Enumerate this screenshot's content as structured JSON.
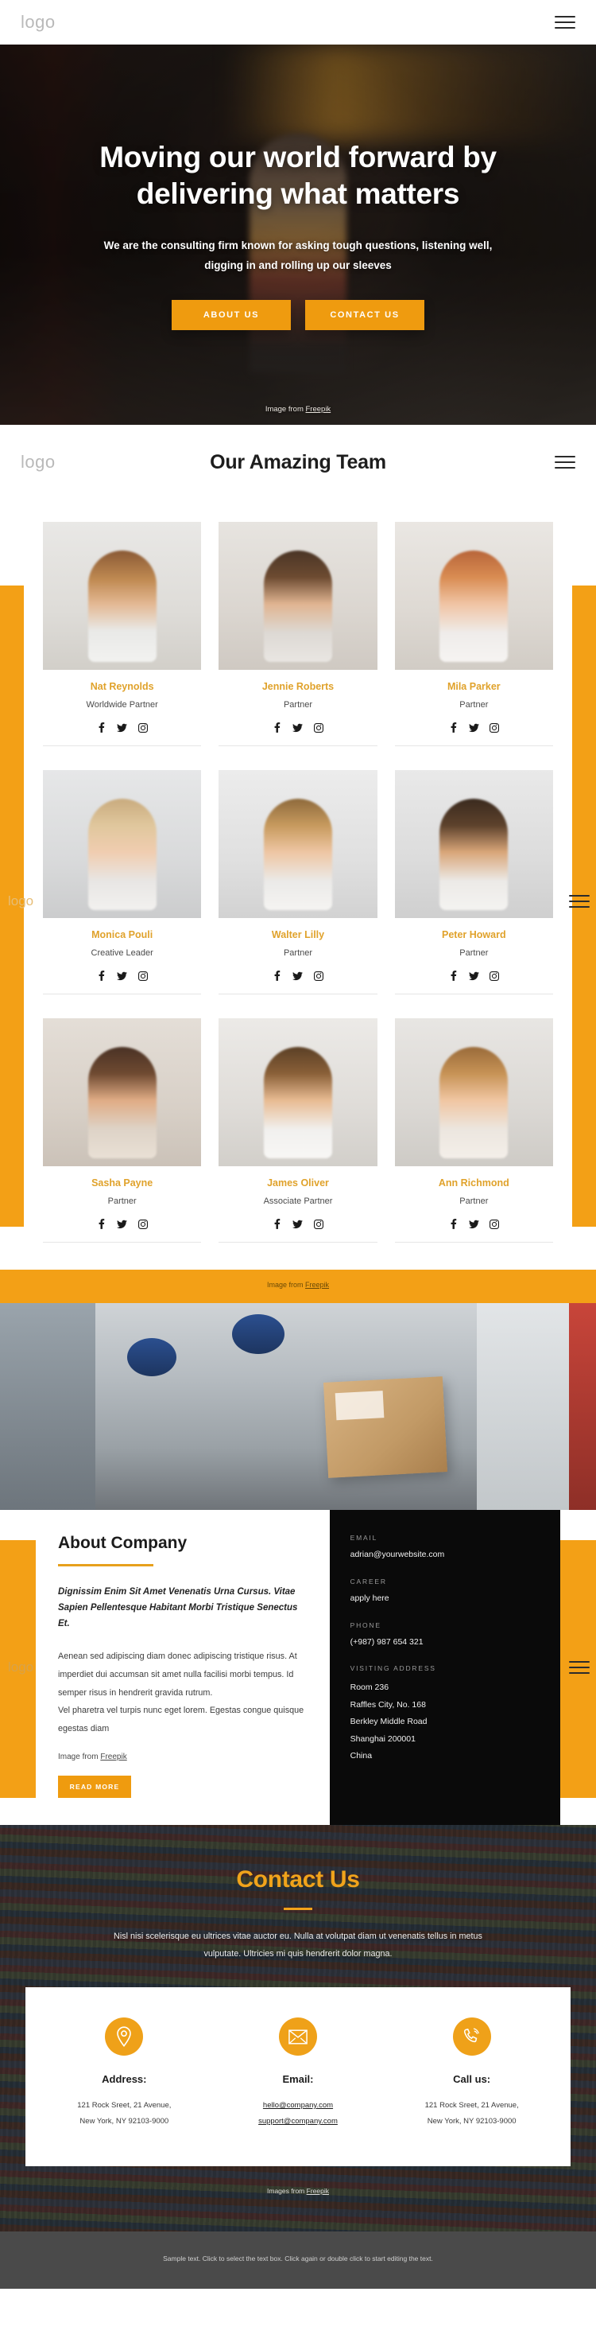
{
  "brand": {
    "logo": "logo",
    "accent": "#ef9b0f",
    "dark": "#0a0a0a"
  },
  "topbar": {
    "logo": "logo",
    "menu_icon": "hamburger-icon"
  },
  "hero": {
    "title": "Moving our world forward by delivering what matters",
    "subtitle": "We are the consulting firm known for asking tough questions, listening well, digging in and rolling up our sleeves",
    "buttons": [
      {
        "label": "ABOUT US"
      },
      {
        "label": "CONTACT US"
      }
    ],
    "credit_prefix": "Image from ",
    "credit_link": "Freepik"
  },
  "team": {
    "logo": "logo",
    "title": "Our Amazing Team",
    "menu_icon": "hamburger-icon",
    "socials": [
      "facebook-icon",
      "twitter-icon",
      "instagram-icon"
    ],
    "members": [
      {
        "name": "Nat Reynolds",
        "role": "Worldwide Partner"
      },
      {
        "name": "Jennie Roberts",
        "role": "Partner"
      },
      {
        "name": "Mila Parker",
        "role": "Partner"
      },
      {
        "name": "Monica Pouli",
        "role": "Creative Leader"
      },
      {
        "name": "Walter Lilly",
        "role": "Partner"
      },
      {
        "name": "Peter Howard",
        "role": "Partner"
      },
      {
        "name": "Sasha Payne",
        "role": "Partner"
      },
      {
        "name": "James Oliver",
        "role": "Associate Partner"
      },
      {
        "name": "Ann Richmond",
        "role": "Partner"
      }
    ],
    "credit_prefix": "Image from ",
    "credit_link": "Freepik"
  },
  "about": {
    "logo": "logo",
    "menu_icon": "hamburger-icon",
    "heading": "About Company",
    "lead": "Dignissim Enim Sit Amet Venenatis Urna Cursus. Vitae Sapien Pellentesque Habitant Morbi Tristique Senectus Et.",
    "paragraphs": [
      "Aenean sed adipiscing diam donec adipiscing tristique risus. At imperdiet dui accumsan sit amet nulla facilisi morbi tempus. Id semper risus in hendrerit gravida rutrum.",
      "Vel pharetra vel turpis nunc eget lorem. Egestas congue quisque egestas diam"
    ],
    "credit_prefix": "Image from ",
    "credit_link": "Freepik",
    "read_more": "READ MORE",
    "contact_info": {
      "email_label": "EMAIL",
      "email_value": "adrian@yourwebsite.com",
      "career_label": "CAREER",
      "career_value": "apply here",
      "phone_label": "PHONE",
      "phone_value": "(+987) 987 654 321",
      "address_label": "VISITING ADDRESS",
      "address_lines": [
        "Room 236",
        "Raffles City, No. 168",
        "Berkley Middle Road",
        "Shanghai 200001",
        "China"
      ]
    }
  },
  "contact": {
    "title": "Contact Us",
    "subtitle": "Nisl nisi scelerisque eu ultrices vitae auctor eu. Nulla at volutpat diam ut venenatis tellus in metus vulputate. Ultricies mi quis hendrerit dolor magna.",
    "columns": [
      {
        "icon": "location-pin-icon",
        "title": "Address:",
        "lines": [
          "121 Rock Sreet, 21 Avenue,",
          "New York, NY 92103-9000"
        ],
        "linked": false
      },
      {
        "icon": "envelope-icon",
        "title": "Email:",
        "lines": [
          "hello@company.com",
          "support@company.com"
        ],
        "linked": true
      },
      {
        "icon": "phone-icon",
        "title": "Call us:",
        "lines": [
          "121 Rock Sreet, 21 Avenue,",
          "New York, NY 92103-9000"
        ],
        "linked": false
      }
    ],
    "credit_prefix": "Images from ",
    "credit_link": "Freepik"
  },
  "footer": {
    "text": "Sample text. Click to select the text box. Click again or double click to start editing the text."
  }
}
